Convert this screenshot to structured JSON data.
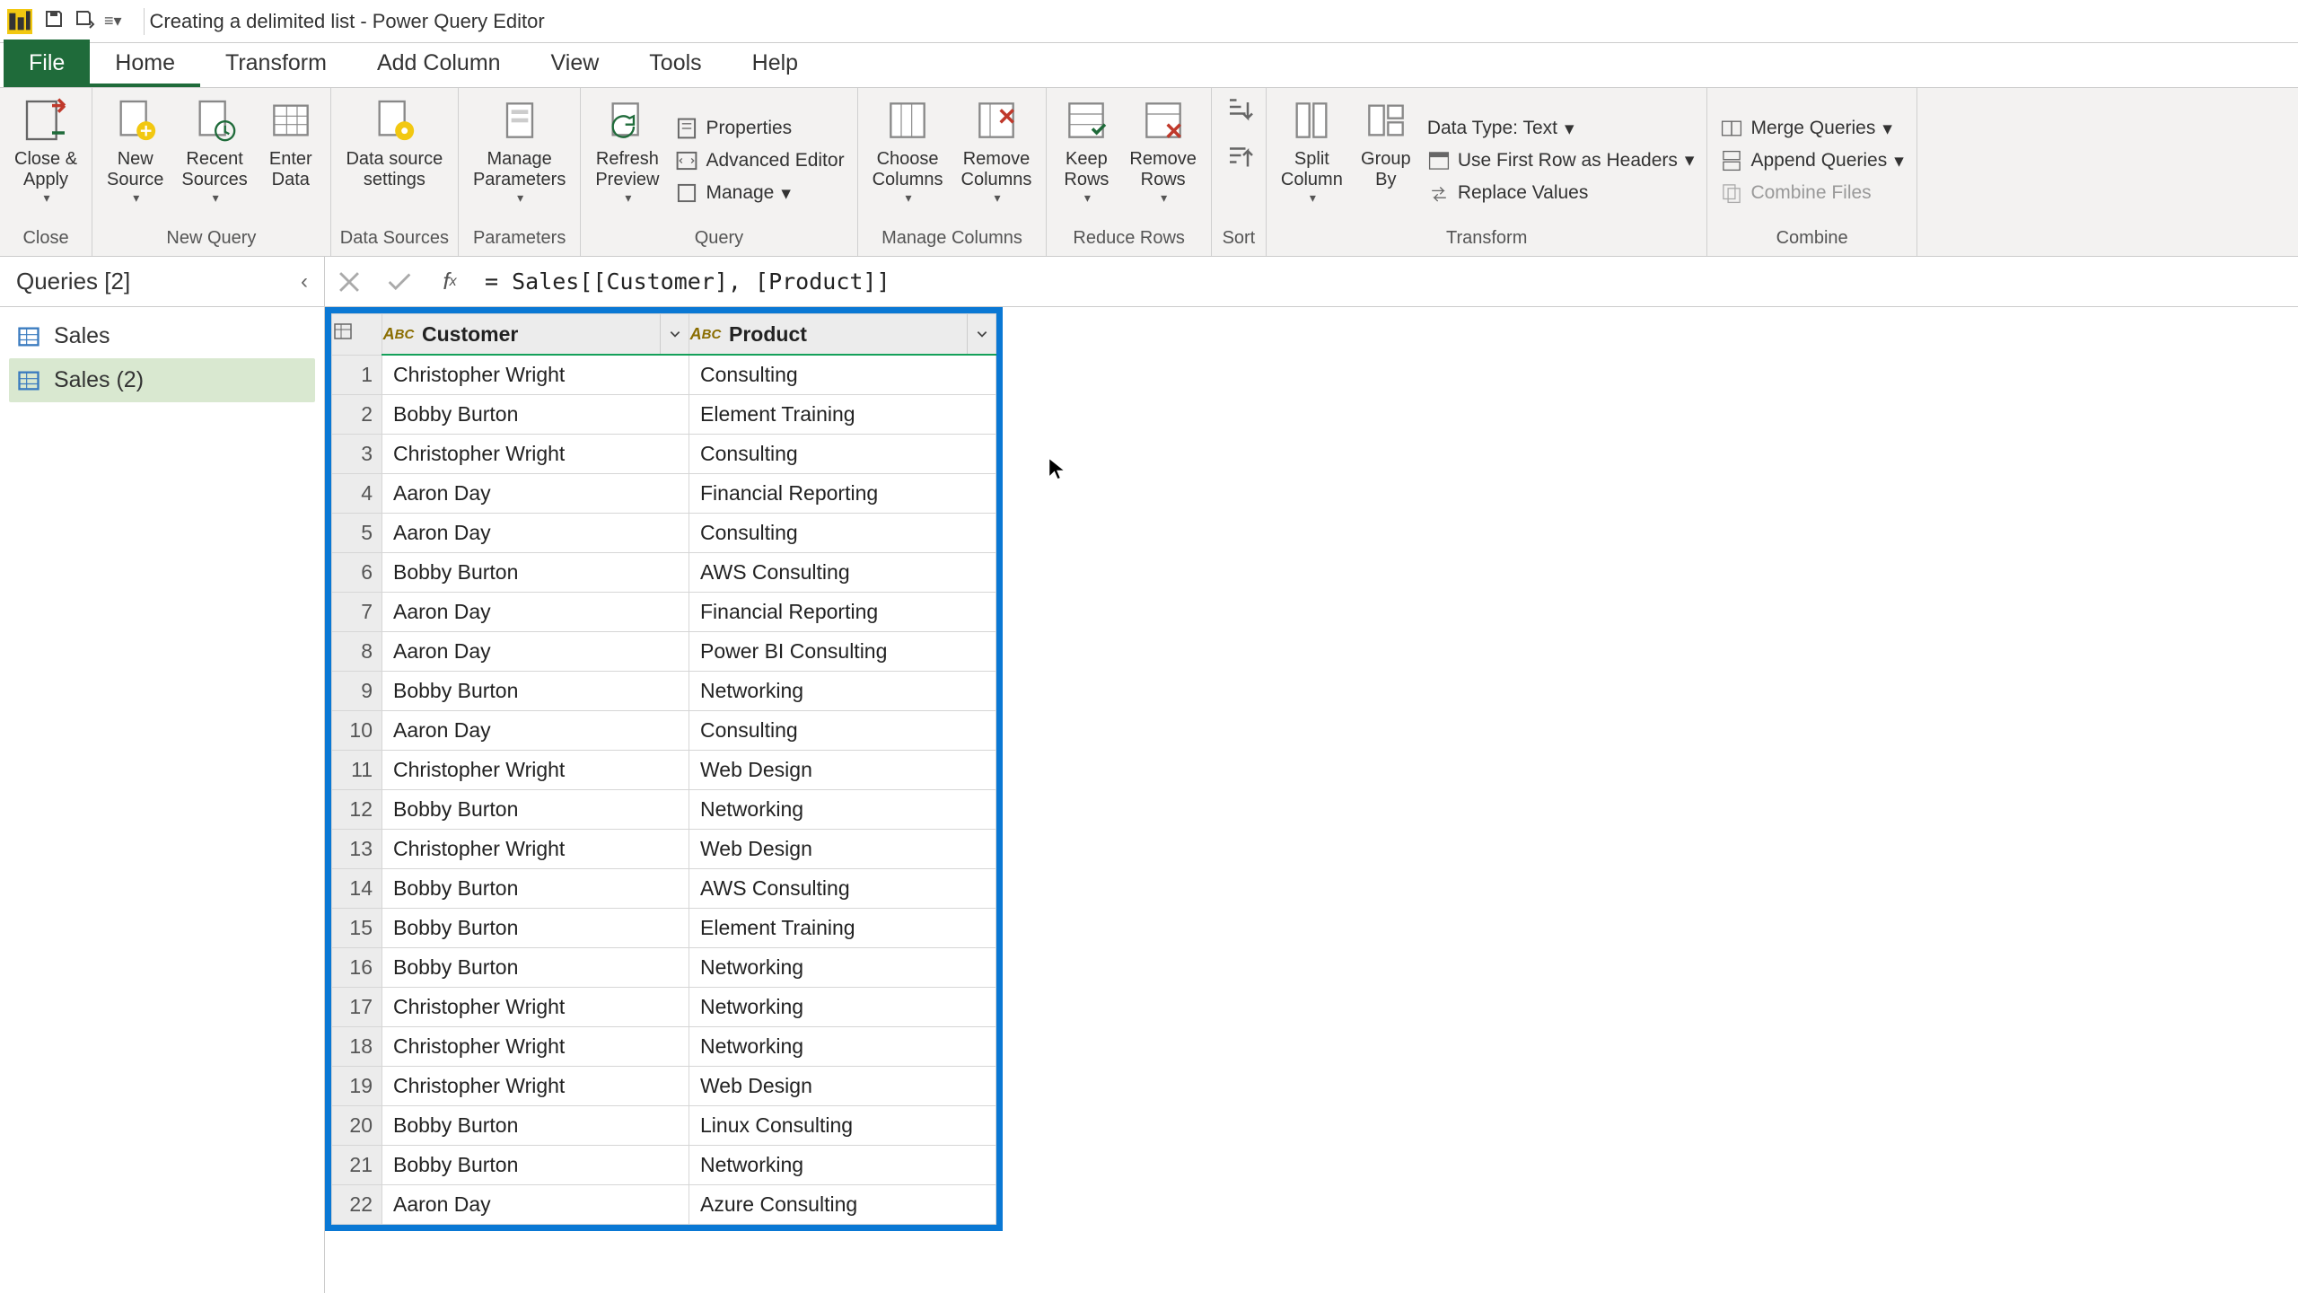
{
  "title": "Creating a delimited list - Power Query Editor",
  "menu": {
    "file": "File",
    "home": "Home",
    "transform": "Transform",
    "addcol": "Add Column",
    "view": "View",
    "tools": "Tools",
    "help": "Help"
  },
  "ribbon": {
    "close": {
      "close_apply": "Close &\nApply",
      "group": "Close"
    },
    "newquery": {
      "new_source": "New\nSource",
      "recent": "Recent\nSources",
      "enter": "Enter\nData",
      "group": "New Query"
    },
    "datasources": {
      "settings": "Data source\nsettings",
      "group": "Data Sources"
    },
    "parameters": {
      "manage": "Manage\nParameters",
      "group": "Parameters"
    },
    "query": {
      "refresh": "Refresh\nPreview",
      "properties": "Properties",
      "adv": "Advanced Editor",
      "manage": "Manage",
      "group": "Query"
    },
    "managecols": {
      "choose": "Choose\nColumns",
      "remove": "Remove\nColumns",
      "group": "Manage Columns"
    },
    "reducerows": {
      "keep": "Keep\nRows",
      "remove": "Remove\nRows",
      "group": "Reduce Rows"
    },
    "sort": {
      "group": "Sort"
    },
    "transform": {
      "split": "Split\nColumn",
      "groupby": "Group\nBy",
      "datatype": "Data Type: Text",
      "firstrow": "Use First Row as Headers",
      "replace": "Replace Values",
      "group": "Transform"
    },
    "combine": {
      "merge": "Merge Queries",
      "append": "Append Queries",
      "combinef": "Combine Files",
      "group": "Combine"
    }
  },
  "queries": {
    "header": "Queries [2]",
    "items": [
      "Sales",
      "Sales (2)"
    ],
    "active": 1
  },
  "formula": "= Sales[[Customer], [Product]]",
  "columns": [
    "Customer",
    "Product"
  ],
  "type_prefix": "A",
  "type_suffix": "C",
  "rows": [
    [
      "Christopher Wright",
      "Consulting"
    ],
    [
      "Bobby Burton",
      "Element Training"
    ],
    [
      "Christopher Wright",
      "Consulting"
    ],
    [
      "Aaron Day",
      "Financial Reporting"
    ],
    [
      "Aaron Day",
      "Consulting"
    ],
    [
      "Bobby Burton",
      "AWS Consulting"
    ],
    [
      "Aaron Day",
      "Financial Reporting"
    ],
    [
      "Aaron Day",
      "Power BI Consulting"
    ],
    [
      "Bobby Burton",
      "Networking"
    ],
    [
      "Aaron Day",
      "Consulting"
    ],
    [
      "Christopher Wright",
      "Web Design"
    ],
    [
      "Bobby Burton",
      "Networking"
    ],
    [
      "Christopher Wright",
      "Web Design"
    ],
    [
      "Bobby Burton",
      "AWS Consulting"
    ],
    [
      "Bobby Burton",
      "Element Training"
    ],
    [
      "Bobby Burton",
      "Networking"
    ],
    [
      "Christopher Wright",
      "Networking"
    ],
    [
      "Christopher Wright",
      "Networking"
    ],
    [
      "Christopher Wright",
      "Web Design"
    ],
    [
      "Bobby Burton",
      "Linux Consulting"
    ],
    [
      "Bobby Burton",
      "Networking"
    ],
    [
      "Aaron Day",
      "Azure Consulting"
    ]
  ],
  "selected_column": 0,
  "selected_row": 0
}
